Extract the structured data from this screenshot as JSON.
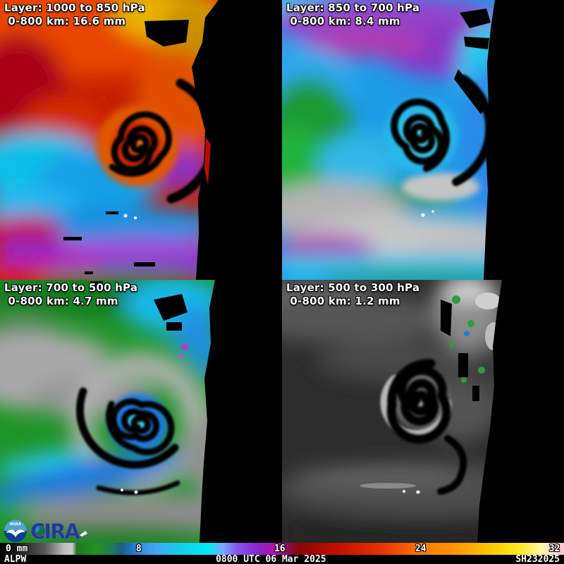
{
  "panels": [
    {
      "layer_label": "Layer: 1000 to 850 hPa",
      "amount_label": " 0-800 km: 16.6 mm"
    },
    {
      "layer_label": "Layer: 850 to 700 hPa",
      "amount_label": " 0-800 km: 8.4 mm"
    },
    {
      "layer_label": "Layer: 700 to 500 hPa",
      "amount_label": " 0-800 km: 4.7 mm"
    },
    {
      "layer_label": "Layer: 500 to 300 hPa",
      "amount_label": " 0-800 km: 1.2 mm"
    }
  ],
  "colorbar": {
    "units": "mm",
    "range": [
      0,
      32
    ],
    "ticks": [
      {
        "label": "0 mm",
        "pos": 1.0,
        "align": "left"
      },
      {
        "label": "8",
        "pos": 24.6,
        "align": "center"
      },
      {
        "label": "16",
        "pos": 49.6,
        "align": "center"
      },
      {
        "label": "24",
        "pos": 74.6,
        "align": "center"
      },
      {
        "label": "32",
        "pos": 99.3,
        "align": "right"
      }
    ],
    "stops": [
      {
        "pos": 0,
        "color": "#000000"
      },
      {
        "pos": 3,
        "color": "#1c1c1c"
      },
      {
        "pos": 8,
        "color": "#5a5a5a"
      },
      {
        "pos": 11.5,
        "color": "#c0c0c0"
      },
      {
        "pos": 12.8,
        "color": "#cccccc"
      },
      {
        "pos": 13.6,
        "color": "#1d7a1d"
      },
      {
        "pos": 17,
        "color": "#239023"
      },
      {
        "pos": 19.5,
        "color": "#20804d"
      },
      {
        "pos": 21.5,
        "color": "#1b5c85"
      },
      {
        "pos": 23,
        "color": "#1f6fc0"
      },
      {
        "pos": 24.6,
        "color": "#2a8ae0"
      },
      {
        "pos": 27.5,
        "color": "#45a5f5"
      },
      {
        "pos": 31,
        "color": "#18c8ea"
      },
      {
        "pos": 37,
        "color": "#00e8f2"
      },
      {
        "pos": 39.5,
        "color": "#7aa8ff"
      },
      {
        "pos": 42,
        "color": "#8855ee"
      },
      {
        "pos": 46,
        "color": "#8822cc"
      },
      {
        "pos": 48.8,
        "color": "#b311a6"
      },
      {
        "pos": 51,
        "color": "#8c0a50"
      },
      {
        "pos": 53,
        "color": "#8a0505"
      },
      {
        "pos": 60,
        "color": "#c41000"
      },
      {
        "pos": 68,
        "color": "#e83500"
      },
      {
        "pos": 74.6,
        "color": "#ff7700"
      },
      {
        "pos": 80,
        "color": "#ff9100"
      },
      {
        "pos": 87,
        "color": "#ffc800"
      },
      {
        "pos": 92,
        "color": "#ffe81e"
      },
      {
        "pos": 96,
        "color": "#fff9a0"
      },
      {
        "pos": 98.5,
        "color": "#ffd3d3"
      },
      {
        "pos": 100,
        "color": "#ffc4cc"
      }
    ]
  },
  "footer": {
    "product": "ALPW",
    "timestamp": "0800 UTC 06 Mar 2025",
    "storm_id": "SH232025"
  },
  "logos": {
    "noaa": "NOAA",
    "cira": "CIRA"
  }
}
